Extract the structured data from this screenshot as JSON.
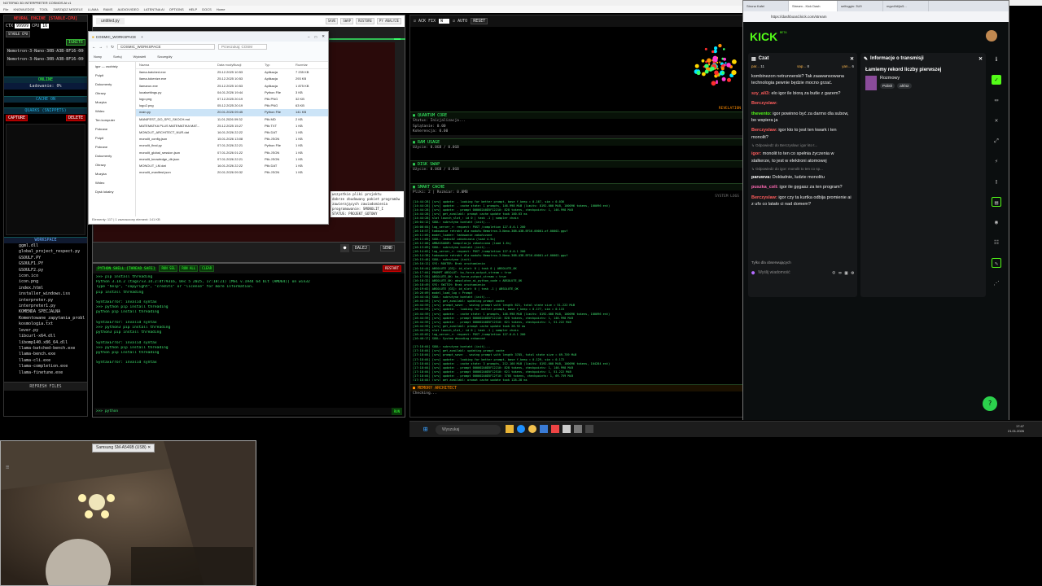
{
  "window_title": "NOTEPAD 3D INTERPRETER COSMOS AI v1",
  "menu": [
    "File",
    "KNOWLEDGE",
    "TOOL",
    "ZARZĄDZ.MODELE",
    "LLAMA",
    "RAMS",
    "AUDIO/VIDEO",
    "LATENTNA AI",
    "OPTIONS",
    "HELP",
    "DOCS",
    "Home"
  ],
  "left_panel": {
    "engine_title": "NEURAL ENGINE [STABLE-CPU]",
    "ctx_label": "CTX",
    "ctx_value": "99999",
    "cpu_label": "CPU",
    "cpu_value": "16",
    "mode": "STABLE CPU",
    "ignite": "IGNITE",
    "model_1": "Nemotron-3-Nano-30B-A3B-BF16-000",
    "model_2": "Nemotron-3-Nano-30B-A3B-BF16-000",
    "status_online": "ONLINE",
    "loading": "Ładowanie: 0%",
    "cache_on": "CACHE ON",
    "quarks": "QUARKS (SNIPPETS)",
    "capture": "CAPTURE",
    "delete": "DELETE",
    "workspace": "WORKSPACE",
    "files": [
      "ggml.dll",
      "global_project_respect.py",
      "GSOULF.PY",
      "GSOULF1.PY",
      "GSOULF2.py",
      "icon.ico",
      "icon.png",
      "index.html",
      "installer_windows.iss",
      "interpreter.py",
      "interpreter1.py",
      "KOMENDA SPECJALNA",
      "Komentowane_zapytania_probl",
      "kosmologia.txt",
      "lever.py",
      "libcurl-x64.dll",
      "libomp140.x86_64.dll",
      "llama-batched-bench.exe",
      "llama-bench.exe",
      "llama-cli.exe",
      "llama-completion.exe",
      "llama-finetune.exe"
    ],
    "refresh": "REFRESH FILES"
  },
  "editor": {
    "tab": "untitled.py",
    "buttons": [
      "SAVE",
      "SWAP",
      "RESTORE",
      "PY ANALYZE"
    ],
    "snippet": [
      "wszystkie pliki projektu",
      "dobrze zbudowany pakiet programów",
      "zawierających zawiadomienia",
      "programowanie: SMONOLIT_I",
      "STATUS: PROJEKT_GOTOWY"
    ],
    "dalej": "DALEJ",
    "send": "SEND"
  },
  "explorer": {
    "title": "COSMIC_WORKSPACE",
    "path": "COSMIC_WORKSPACE",
    "search": "Przeszukaj: COSM",
    "toolbar": [
      "Nowy",
      "Sortuj",
      "Wyświetl",
      "Szczegóły"
    ],
    "nav": [
      "igor — osobisty",
      "Pulpit",
      "Dokumenty",
      "Obrazy",
      "Muzyka",
      "Wideo",
      "Ten komputer",
      "Pobrane",
      "Pulpit",
      "Pobrane",
      "Dokumenty",
      "Obrazy",
      "Muzyka",
      "Wideo",
      "Dysk lokalny"
    ],
    "columns": [
      "Nazwa",
      "Data modyfikacji",
      "Typ",
      "Rozmiar"
    ],
    "rows": [
      [
        "llama-batched.exe",
        "25.12.2025 10:53",
        "Aplikacja",
        "7 235 KB"
      ],
      [
        "llama-tokenize.exe",
        "25.12.2025 10:53",
        "Aplikacja",
        "293 KB"
      ],
      [
        "llamarun.exe",
        "25.12.2025 10:53",
        "Aplikacja",
        "1 875 KB"
      ],
      [
        "localsettings.py",
        "04.01.2026 19:44",
        "Python File",
        "3 KB"
      ],
      [
        "logo.png",
        "07.12.2025 20:19",
        "Plik PNG",
        "32 KB"
      ],
      [
        "logo2.png",
        "05.12.2025 20:19",
        "Plik PNG",
        "63 KB"
      ],
      [
        "main.py",
        "20.01.2026 09:45",
        "Python File",
        "141 KB"
      ],
      [
        "MANIFEST_DO_SPC_SKOCH.md",
        "11.01.2026 09:32",
        "Plik MD",
        "2 KB"
      ],
      [
        "MATEMATKA PLUS MATEMATIKA MAT...",
        "25.12.2025 15:27",
        "Plik TXT",
        "1 KB"
      ],
      [
        "MONOLIT_ARCHITECT_NUR.dat",
        "16.01.2026 22:22",
        "Plik DAT",
        "1 KB"
      ],
      [
        "monolit_config.json",
        "15.01.2026 13:08",
        "Plik JSON",
        "1 KB"
      ],
      [
        "monolit_final.py",
        "07.01.2026 22:21",
        "Python File",
        "1 KB"
      ],
      [
        "monolit_global_session.json",
        "07.01.2026 01:22",
        "Plik JSON",
        "1 KB"
      ],
      [
        "monolit_knowledge_db.json",
        "07.01.2026 22:21",
        "Plik JSON",
        "1 KB"
      ],
      [
        "MONOLIT_LM.dat",
        "16.01.2026 22:22",
        "Plik DAT",
        "1 KB"
      ],
      [
        "monolit_manifest.json",
        "20.01.2026 09:32",
        "Plik JSON",
        "1 KB"
      ]
    ],
    "status": "Elementy: 117  |  1 zaznaczony element: 141 KB"
  },
  "shell": {
    "title": "PYTHON SHELL [THREAD SAFE]",
    "buttons": [
      "RUN SEL",
      "RUN ALL",
      "CLEAR"
    ],
    "restart": "RESTART",
    "lines": [
      ">>> pip install threading",
      "Python 3.14.2 (tags/v3.14.2:df79316, Dec  5 2025, 17:18:21) [MSC v.1944 64 bit (AMD64)] on win32",
      "Type \"help\", \"copyright\", \"credits\" or \"license\" for more information.",
      "pip install threading",
      "",
      "SyntaxError: invalid syntax",
      ">>> python pip install threading",
      "python pip install threading",
      "",
      "SyntaxError: invalid syntax",
      ">>> python3 pip install threading",
      "python3 pip install threading",
      "",
      "SyntaxError: invalid syntax",
      ">>> python pip install threading",
      "python pip install threading",
      "",
      "SyntaxError: invalid syntax"
    ],
    "prompt": ">>> python",
    "run": "RUN"
  },
  "middle": {
    "ack": "ACK FIX",
    "ack_value": "W",
    "auto": "AUTO",
    "reset": "RESET",
    "revelation": "REVELATION",
    "quantum": "QUANTUM CORE",
    "quantum_lines": [
      "Status: Inicjalizacja...",
      "Splątanie: 0.00",
      "Koherencja: 0.00"
    ],
    "ram": "RAM USAGE",
    "ram_line": "Użycie: 0.0GB / 0.0GB",
    "disk": "DISK SWAP",
    "disk_line": "Użycie: 0.0GB / 0.0GB",
    "smart": "SMART CACHE",
    "smart_line": "Pliki: 2 | Rozmiar: 0.0MB",
    "system_logs": "SYSTEM LOGS",
    "logs": [
      "[14:44:28] [srv]    update:    - looking for better prompt, base f_keep = 0.167, sim = 0.036",
      "[14:44:28] [srv]    update:    - cache state: 1 prompts, 146.998 MiB (limits: 8192.000 MiB, 100096 tokens, 100096 est)",
      "[14:44:28] [srv]    update:     - prompt 000002A0D5F12210:     828 tokens, checkpoints: 1,   146.998 MiB",
      "[14:44:28] [srv]  get_availabl: prompt cache update took 100.63 ms",
      "[14:44:28] slot launch_slot_: id 0 | task -1 | sampler chain",
      "[16:04:12] SOUL: subrutyna kontakt (init)...",
      "[16:06:04] log_server_r: request: POST /completion 127.0.0.1 200",
      "[16:10:57] ładowanie retrakt dla modułu Nemotron-3-Nano-30B-A3B-BF16-00001-of-00002.gguf",
      "[16:11:05] model_loader: ładowanie zakończone",
      "[16:11:05] SOUL: Jedność zakończona (load 4.5s)",
      "[16:12:00] AMBASSADOR: kompilacja zakończona (load 1.6s)",
      "[16:13:09] SOUL: subrutyna kontakt (init)...",
      "[16:14:02] log_server_r: request: POST /completion 127.0.0.1 200",
      "[16:14:38] ładowanie retrakt dla modułu Nemotron-3-Nano-30B-A3B-BF16-00001-of-00002.gguf",
      "[16:15:46] SOUL: subrutyna (init)",
      "[16:16:12] SYS: ROUTER: Brak uruchomienia",
      "[16:16:44] ABSOLUTE [GS]: id_slot: 0 | task 0 | ABSOLUTE_OK",
      "[16:17:04] PROMPT ABSOLUT: ko_force_output_stream = true",
      "[16:17:55] ABSOLUTE_OK: ko_force_output_stream = true",
      "[16:18:32] ABSOLUTE_OK: absolutne_ai_python_code = ABSOLUTE_OK",
      "[16:18:49] SYS: SWITCH: Brak uruchomienia",
      "[16:19:02] ABSOLUTE [GS]: id_slot: 0 | task -1 | ABSOLUTE_OK",
      "[16:26:09] model_load_log = Prompt",
      "[16:44:44] SOUL: subrutyna kontakt (init)...",
      "[16:44:59] [srv]  get_availabl: updating prompt cache",
      "[16:44:59] [srv]    prompt_save:  - saving prompt with length 621, total state size = 51.222 MiB",
      "[16:44:59] [srv]    update:    - looking for better prompt, base f_keep = 0.177, sim = 0.115",
      "[16:44:59] [srv]    update:    - cache state: 1 prompts, 146.998 MiB (limits: 8192.000 MiB, 100096 tokens, 100096 est)",
      "[16:44:59] [srv]    update:     - prompt 000002A0D5F12210:     828 tokens, checkpoints: 1,   146.998 MiB",
      "[16:44:59] [srv]    update:     - prompt 000002A0D5F12510:     621 tokens, checkpoints: 1,    51.222 MiB",
      "[16:44:59] [srv]  get_availabl: prompt cache update took 28.92 ms",
      "[16:44:59] slot launch_slot_: id 0 | task -1 | sampler chain",
      "[16:45:02] log_server_r: request: POST /completion 127.0.0.1 200",
      "[16:46:17] SOUL: System decoding enhanced",
      "",
      "[17:18:04] SOUL: subrutyna kontakt (init)...",
      "[17:18:04] [srv]  get_availabl: updating prompt cache",
      "[17:18:04] [srv]    prompt_save:  - saving prompt with length 3785, total state size = 69.759 MiB",
      "[17:18:04] [srv]    update:    - looking for better prompt, base f_keep = 0.129, sim = 0.172",
      "[17:18:04] [srv]    update:    - cache state: 3 prompts, 212.160 MiB (limits: 8192.000 MiB, 100096 tokens, 104284 est)",
      "[17:18:04] [srv]    update:     - prompt 000002A0D5F12210:     828 tokens, checkpoints: 1,   146.998 MiB",
      "[17:18:04] [srv]    update:     - prompt 000002A0D5F12510:     621 tokens, checkpoints: 1,    51.222 MiB",
      "[17:18:04] [srv]    update:     - prompt 000002A0D5F12F10:    3785 tokens, checkpoints: 1,    69.759 MiB",
      "[17:18:04] [srv]  get_availabl: prompt cache update took 128.28 ms"
    ],
    "memory": "MEMORY ARCHITECT",
    "memory_line": "Checking..."
  },
  "browser": {
    "tabs": [
      "Strona Kafel",
      "Stream - Kick Dash",
      "selfoggin: 3U9",
      "mgvd/ld/jiu5..."
    ],
    "url": "https://dashboard.kick.com/stream",
    "logo": "KICK",
    "beta": "BETA",
    "chat_title": "Czat",
    "info_title": "Informacje o transmisji",
    "info_text": "Łamiemy rekord liczby pierwszej",
    "category": "Rozmowy",
    "tags": [
      "Polish",
      "ahf42"
    ],
    "top_users": [
      {
        "name": "par...",
        "count": "11"
      },
      {
        "name": "sap...",
        "count": "8"
      },
      {
        "name": "yan...",
        "count": "6"
      }
    ],
    "messages": [
      {
        "user": "",
        "text": "kombinezon netrunnerski? Tak zaawansowana technologia pewnie będzie mocno grzać.",
        "color": "#ffffff"
      },
      {
        "user": "szy_ali3:",
        "text": "elo igor ile biorą za butle z gazem?",
        "color": "#ff5c5c"
      },
      {
        "user": "Berczyslaw:",
        "text": "",
        "color": "#ff5c5c"
      },
      {
        "user": "thevento:",
        "text": "igor powinno być za darmo dla subow, bo wspiera ja",
        "color": "#53fc18"
      },
      {
        "user": "Berczyslaw:",
        "text": "igor kto to jest ten kwark i ten monolit?",
        "color": "#ff5c5c"
      },
      {
        "user": "igor:",
        "text": "monolit to ten co spełnia życzenia w stalkerze, to jest w elektroni atomowej",
        "color": "#ff5c5c"
      },
      {
        "user": "paruwva:",
        "text": "Dokładnie, ludzie monolitu",
        "color": "#ffffff"
      },
      {
        "user": "puszka_coli:",
        "text": "igor ile gęgasz za ten program?",
        "color": "#ff69b4"
      },
      {
        "user": "Berczyslaw:",
        "text": "igor czy ta kurtka odbija promienie ai z ufo co latało ci nad domem?",
        "color": "#ff5c5c"
      }
    ],
    "replies": [
      "Odpowiedz do Berczyslaw: igor kto t...",
      "Odpowiedz do igor: monolit to ten co sp..."
    ],
    "followers_only": "Tylko dla obserwujących",
    "send_placeholder": "Wyślij wiadomość"
  },
  "taskbar": {
    "search": "Wyszukaj",
    "time": "17:47",
    "date": "21.01.2026"
  },
  "webcam": {
    "device": "Samsung SM-A546B (USB)"
  }
}
